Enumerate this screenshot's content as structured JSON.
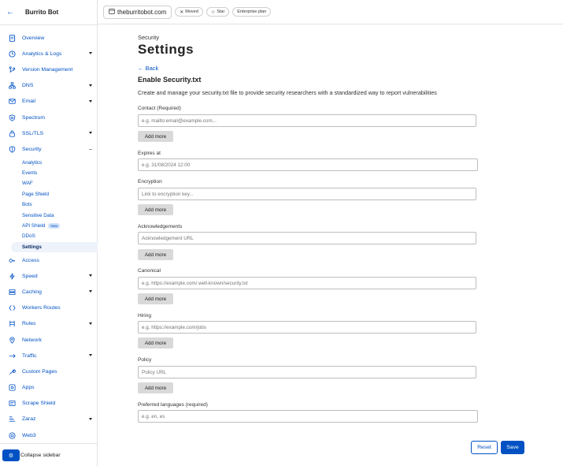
{
  "sidebar": {
    "account_name": "Burrito Bot",
    "items": [
      {
        "label": "Overview",
        "icon": "document-icon",
        "caret": false
      },
      {
        "label": "Analytics & Logs",
        "icon": "clock-icon",
        "caret": true
      },
      {
        "label": "Version Management",
        "icon": "branch-icon",
        "caret": false
      },
      {
        "label": "DNS",
        "icon": "network-tree-icon",
        "caret": true
      },
      {
        "label": "Email",
        "icon": "envelope-icon",
        "caret": true
      },
      {
        "label": "Spectrum",
        "icon": "shield-check-icon",
        "caret": false
      },
      {
        "label": "SSL/TLS",
        "icon": "lock-icon",
        "caret": true
      },
      {
        "label": "Security",
        "icon": "shield-icon",
        "caret": true
      }
    ],
    "security_sub": [
      {
        "label": "Analytics"
      },
      {
        "label": "Events"
      },
      {
        "label": "WAF"
      },
      {
        "label": "Page Shield"
      },
      {
        "label": "Bots"
      },
      {
        "label": "Sensitive Data"
      },
      {
        "label": "API Shield",
        "badge": "New"
      },
      {
        "label": "DDoS"
      },
      {
        "label": "Settings",
        "active": true
      }
    ],
    "items_after": [
      {
        "label": "Access",
        "icon": "access-icon",
        "caret": false
      },
      {
        "label": "Speed",
        "icon": "lightning-icon",
        "caret": true
      },
      {
        "label": "Caching",
        "icon": "cache-icon",
        "caret": true
      },
      {
        "label": "Workers Routes",
        "icon": "workers-icon",
        "caret": false
      },
      {
        "label": "Rules",
        "icon": "rules-icon",
        "caret": true
      },
      {
        "label": "Network",
        "icon": "location-icon",
        "caret": false
      },
      {
        "label": "Traffic",
        "icon": "traffic-icon",
        "caret": true
      },
      {
        "label": "Custom Pages",
        "icon": "wrench-icon",
        "caret": false
      },
      {
        "label": "Apps",
        "icon": "apps-icon",
        "caret": false
      },
      {
        "label": "Scrape Shield",
        "icon": "scrape-icon",
        "caret": false
      },
      {
        "label": "Zaraz",
        "icon": "zaraz-icon",
        "caret": true
      },
      {
        "label": "Web3",
        "icon": "web3-icon",
        "caret": false
      }
    ],
    "collapse_label": "Collapse sidebar"
  },
  "topbar": {
    "domain": "theburritobot.com",
    "tags": [
      {
        "label": "Moved",
        "icon": "x-icon"
      },
      {
        "label": "Star",
        "icon": "star-icon"
      },
      {
        "label": "Enterprise plan",
        "icon": ""
      }
    ]
  },
  "main": {
    "breadcrumb": "Security",
    "title": "Settings",
    "back_label": "← Back",
    "section_title": "Enable Security.txt",
    "description": "Create and manage your security.txt file to provide security researchers with a standardized way to report vulnerabilities",
    "fields": [
      {
        "label": "Contact (Required)",
        "placeholder": "e.g. mailto:email@example.com...",
        "add_more": true
      },
      {
        "label": "Expires at",
        "placeholder": "e.g. 31/08/2024 12:00",
        "add_more": false
      },
      {
        "label": "Encryption",
        "placeholder": "Link to encryption key...",
        "add_more": true
      },
      {
        "label": "Acknowledgements",
        "placeholder": "Acknowledgement URL",
        "add_more": true
      },
      {
        "label": "Canonical",
        "placeholder": "e.g. https://example.com/.well-known/security.txt",
        "add_more": true
      },
      {
        "label": "Hiring",
        "placeholder": "e.g. https://example.com/jobs",
        "add_more": true
      },
      {
        "label": "Policy",
        "placeholder": "Policy URL",
        "add_more": true
      },
      {
        "label": "Preferred languages (required)",
        "placeholder": "e.g. en, es",
        "add_more": false
      }
    ],
    "add_more_label": "Add more",
    "reset_label": "Reset",
    "save_label": "Save"
  },
  "colors": {
    "accent": "#0051c3",
    "border": "#e2e2e2"
  }
}
